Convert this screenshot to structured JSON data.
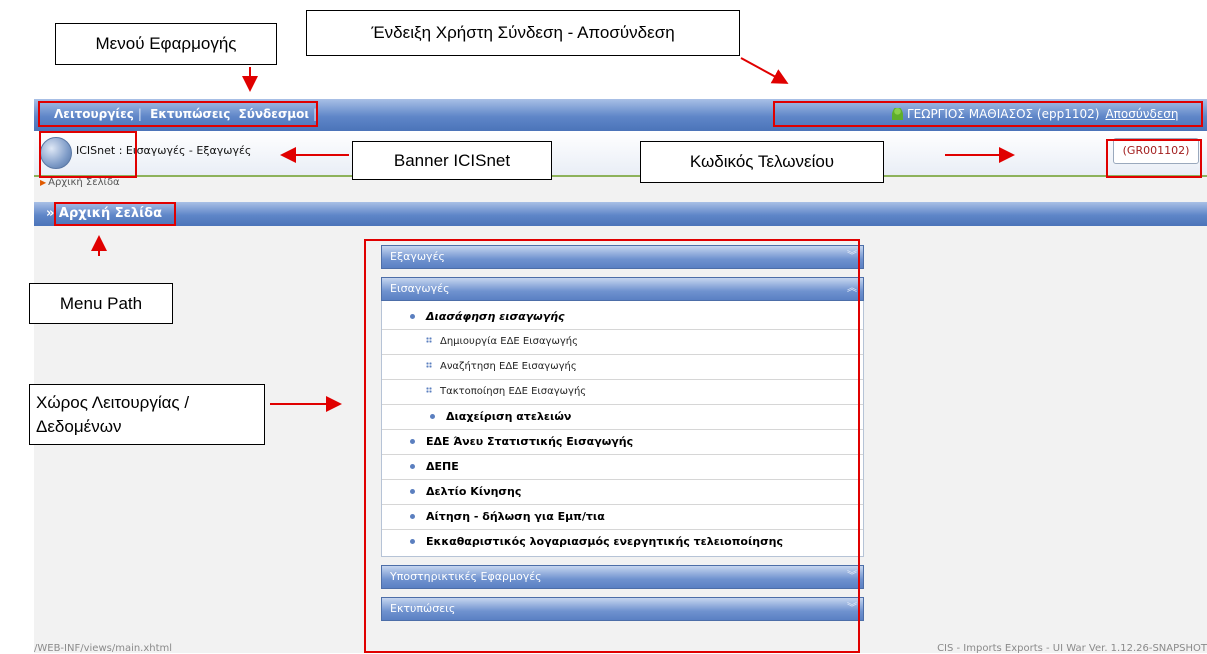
{
  "annotations": {
    "app_menu": "Μενού Εφαρμογής",
    "user_indicator": "Ένδειξη Χρήστη Σύνδεση - Αποσύνδεση",
    "banner": "Banner ICISnet",
    "customs_office_code": "Κωδικός Τελωνείου",
    "menu_path": "Menu Path",
    "workspace_line1": "Χώρος Λειτουργίας /",
    "workspace_line2": "Δεδομένων"
  },
  "topbar": {
    "menu": [
      "Λειτουργίες",
      "Εκτυπώσεις",
      "Σύνδεσμοι"
    ],
    "user": "ΓΕΩΡΓΙΟΣ ΜΑΘΙΑΣΟΣ (epp1102)",
    "logout": "Αποσύνδεση"
  },
  "banner": {
    "title": "ICISnet : Εισαγωγές - Εξαγωγές",
    "customs_code": "(GR001102)"
  },
  "breadcrumb": "Αρχική Σελίδα",
  "path": "» Αρχική Σελίδα",
  "accordion": {
    "exports": "Εξαγωγές",
    "imports": "Εισαγωγές",
    "imports_items": {
      "clearance": "Διασάφηση εισαγωγής",
      "create": "Δημιουργία ΕΔΕ Εισαγωγής",
      "search": "Αναζήτηση ΕΔΕ Εισαγωγής",
      "settle": "Τακτοποίηση ΕΔΕ Εισαγωγής",
      "exemptions": "Διαχείριση ατελειών",
      "no_stats": "ΕΔΕ Άνευ Στατιστικής Εισαγωγής",
      "depe": "ΔΕΠΕ",
      "movement": "Δελτίο Κίνησης",
      "application": "Αίτηση - δήλωση για Εμπ/τια",
      "clearing_account": "Εκκαθαριστικός λογαριασμός ενεργητικής τελειοποίησης"
    },
    "support_apps": "Υποστηρικτικές Εφαρμογές",
    "prints": "Εκτυπώσεις"
  },
  "footer": {
    "left": "/WEB-INF/views/main.xhtml",
    "right": "CIS - Imports Exports - UI War Ver. 1.12.26-SNAPSHOT"
  },
  "colors": {
    "annotation_red": "#e00000",
    "header_blue": "#5f86c8",
    "accent_green": "#8db25b"
  }
}
